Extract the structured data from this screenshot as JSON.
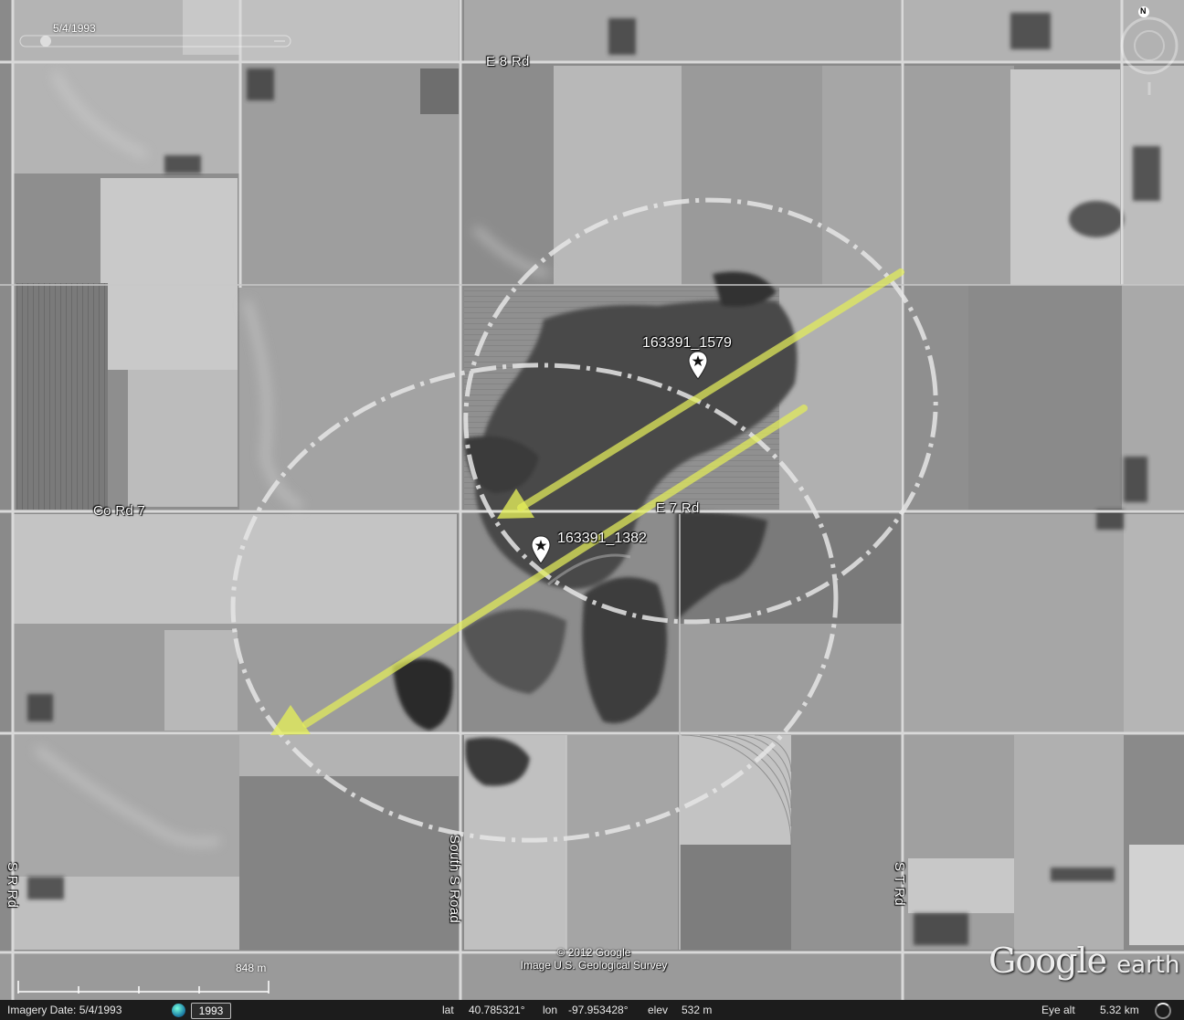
{
  "map": {
    "imagery_date_overlay": "5/4/1993",
    "roads": {
      "e8": "E 8 Rd",
      "co7": "Co Rd 7",
      "e7": "E 7 Rd",
      "south_s": "South S Road",
      "s_r": "S R Rd",
      "s_t": "S T Rd"
    },
    "placemarks": [
      {
        "label": "163391_1579",
        "icon": "star-pin-icon"
      },
      {
        "label": "163391_1382",
        "icon": "star-pin-icon"
      }
    ],
    "annotations": {
      "arrow_color": "#e4ee5a",
      "ellipse_color": "#e6e6e6"
    },
    "copyright_line1": "© 2012 Google",
    "copyright_line2": "Image U.S. Geological Survey",
    "logo": {
      "google": "Google",
      "earth": "earth"
    },
    "scale_label": "848 m",
    "compass_letter": "N"
  },
  "status_bar": {
    "imagery_date_label": "Imagery Date: 5/4/1993",
    "year_button": "1993",
    "lat_label": "lat",
    "lat_value": "40.785321°",
    "lon_label": "lon",
    "lon_value": "-97.953428°",
    "elev_label": "elev",
    "elev_value": "532 m",
    "eye_alt_label": "Eye alt",
    "eye_alt_value": "5.32 km"
  }
}
